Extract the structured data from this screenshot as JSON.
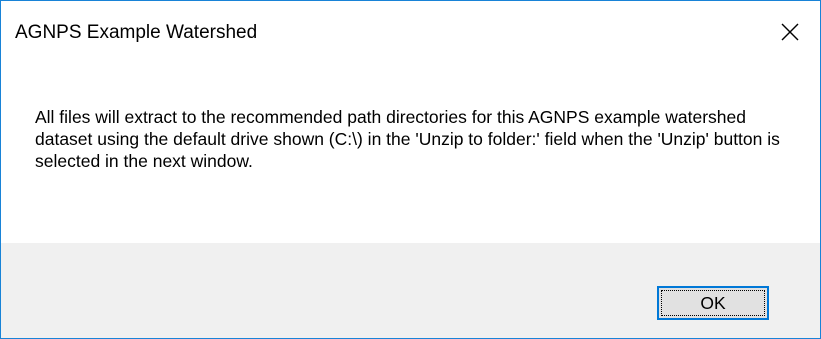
{
  "window": {
    "title": "AGNPS Example Watershed",
    "close_icon": "close-icon"
  },
  "message": {
    "text": "All files will extract to the recommended path directories for this AGNPS example watershed dataset using the default drive shown (C:\\) in the 'Unzip to folder:' field when the 'Unzip' button is selected in the next window."
  },
  "buttons": {
    "ok_label": "OK"
  },
  "colors": {
    "window_border": "#1883d7",
    "footer_background": "#f0f0f0",
    "button_background": "#e1e1e1",
    "button_focus_border": "#0078d7"
  }
}
